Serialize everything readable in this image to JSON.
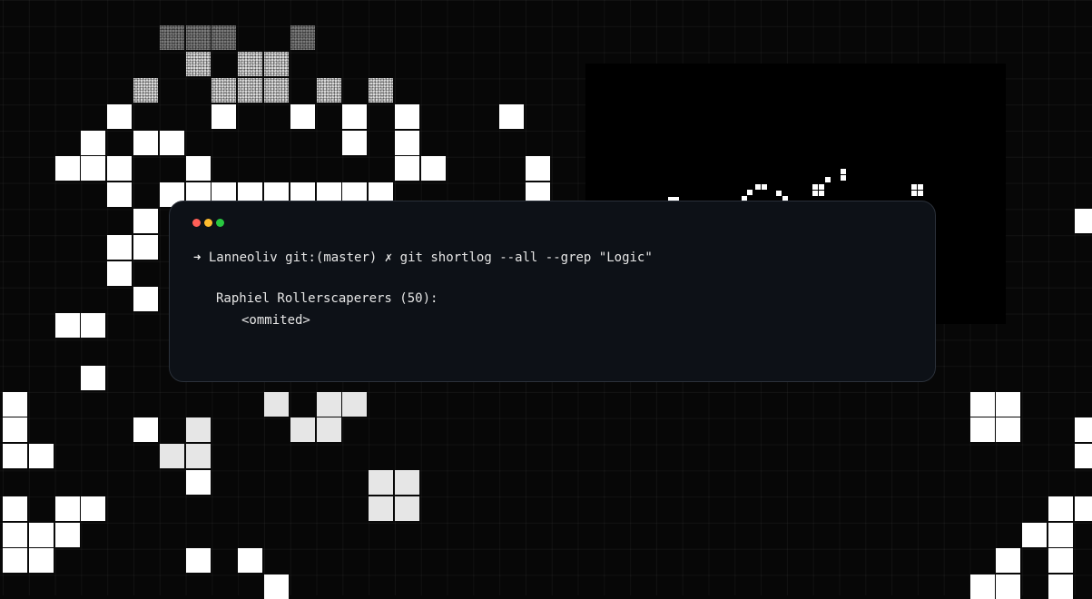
{
  "background": {
    "color": "#070707",
    "cell_color": "#ffffff"
  },
  "terminal": {
    "window_controls": [
      "close-dot",
      "minimize-dot",
      "maximize-dot"
    ],
    "control_colors": [
      "#ff5f57",
      "#febc2e",
      "#28c840"
    ],
    "prompt_arrow": "➜",
    "prompt_dir": "Lanneoliv",
    "prompt_branch": "git:(master)",
    "prompt_dirty": "✗",
    "command": "git shortlog --all --grep \"Logic\"",
    "author": "Raphiel Rollerscaperers (50):",
    "commit_body": "<ommited>"
  }
}
